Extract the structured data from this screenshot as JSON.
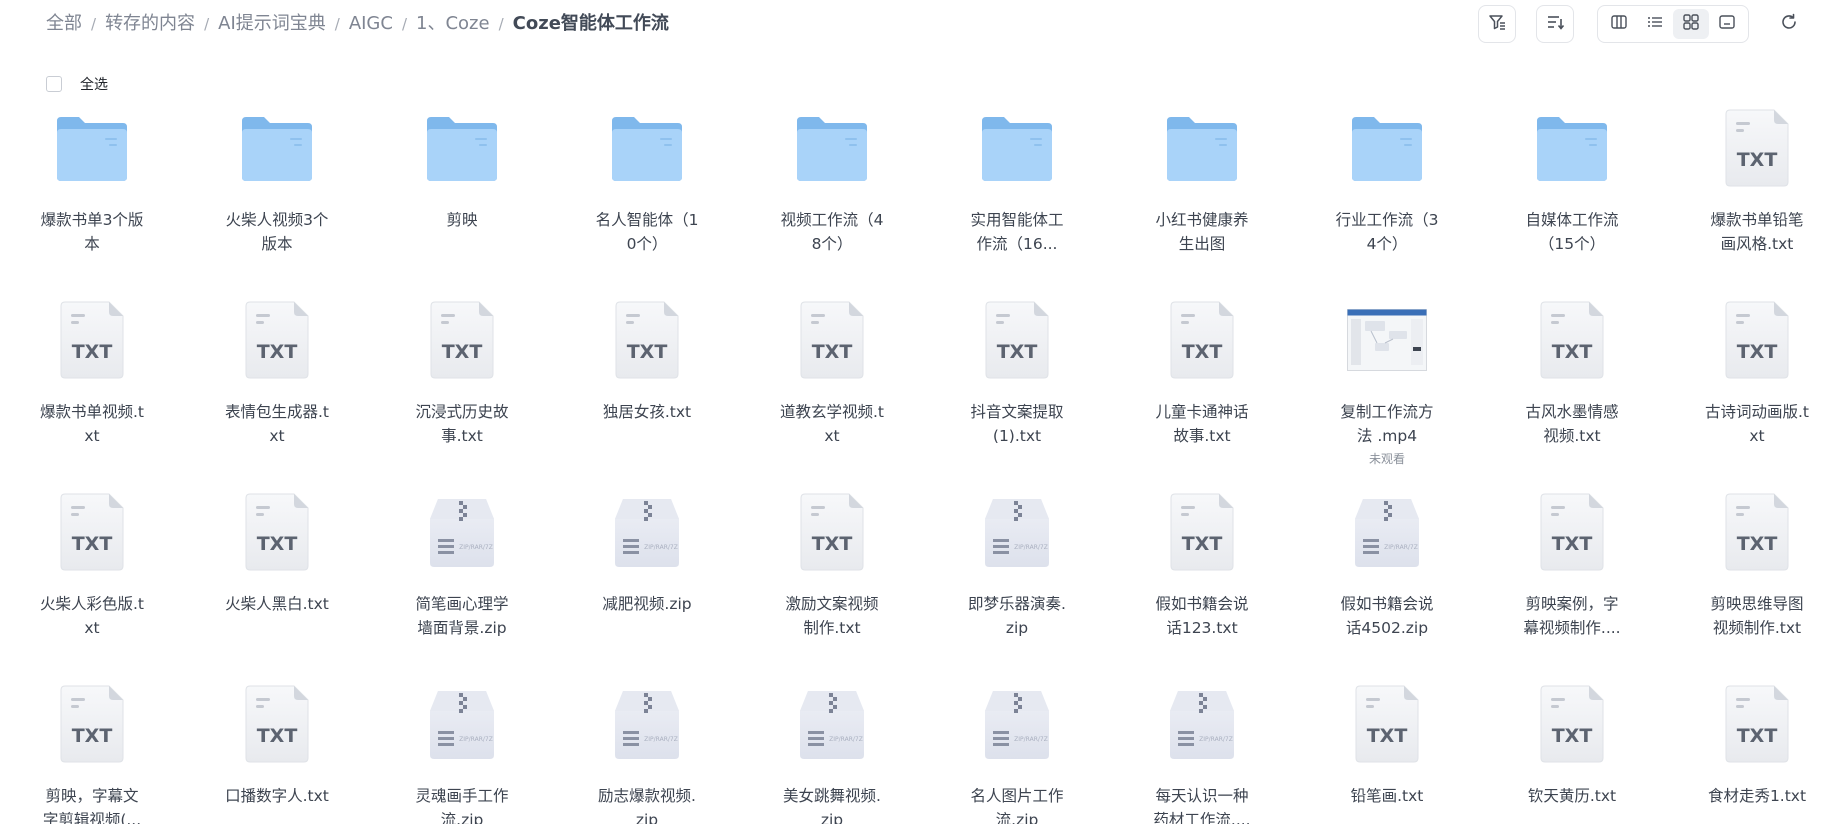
{
  "breadcrumb": [
    "全部",
    "转存的内容",
    "AI提示词宝典",
    "AIGC",
    "1、Coze",
    "Coze智能体工作流"
  ],
  "toolbar": {
    "filter_icon": "filter-icon",
    "sort_icon": "sort-icon",
    "views": [
      "columns-view-icon",
      "list-view-icon",
      "grid-view-icon",
      "preview-view-icon"
    ],
    "active_view": "grid-view-icon",
    "refresh_icon": "refresh-icon"
  },
  "select_all_label": "全选",
  "colors": {
    "folder_back": "#7fb8ec",
    "folder_front": "#a9d3f9",
    "text": "#3d4450",
    "crumb": "#7f8592",
    "crumb_current": "#424a57"
  },
  "items": [
    {
      "name": "爆款书单3个版本",
      "type": "folder"
    },
    {
      "name": "火柴人视频3个版本",
      "type": "folder"
    },
    {
      "name": "剪映",
      "type": "folder"
    },
    {
      "name": "名人智能体（10个）",
      "type": "folder"
    },
    {
      "name": "视频工作流（48个）",
      "type": "folder"
    },
    {
      "name": "实用智能体工作流（16...",
      "type": "folder"
    },
    {
      "name": "小红书健康养生出图",
      "type": "folder"
    },
    {
      "name": "行业工作流（34个）",
      "type": "folder"
    },
    {
      "name": "自媒体工作流（15个）",
      "type": "folder"
    },
    {
      "name": "爆款书单铅笔画风格.txt",
      "type": "txt"
    },
    {
      "name": "爆款书单视频.txt",
      "type": "txt"
    },
    {
      "name": "表情包生成器.txt",
      "type": "txt"
    },
    {
      "name": "沉浸式历史故事.txt",
      "type": "txt"
    },
    {
      "name": "独居女孩.txt",
      "type": "txt"
    },
    {
      "name": "道教玄学视频.txt",
      "type": "txt"
    },
    {
      "name": "抖音文案提取(1).txt",
      "type": "txt"
    },
    {
      "name": "儿童卡通神话故事.txt",
      "type": "txt"
    },
    {
      "name": "复制工作流方法 .mp4",
      "type": "video",
      "note": "未观看"
    },
    {
      "name": "古风水墨情感视频.txt",
      "type": "txt"
    },
    {
      "name": "古诗词动画版.txt",
      "type": "txt"
    },
    {
      "name": "火柴人彩色版.txt",
      "type": "txt"
    },
    {
      "name": "火柴人黑白.txt",
      "type": "txt"
    },
    {
      "name": "简笔画心理学墙面背景.zip",
      "type": "zip"
    },
    {
      "name": "减肥视频.zip",
      "type": "zip"
    },
    {
      "name": "激励文案视频制作.txt",
      "type": "txt"
    },
    {
      "name": "即梦乐器演奏.zip",
      "type": "zip"
    },
    {
      "name": "假如书籍会说话123.txt",
      "type": "txt"
    },
    {
      "name": "假如书籍会说话4502.zip",
      "type": "zip"
    },
    {
      "name": "剪映案例，字幕视频制作....",
      "type": "txt"
    },
    {
      "name": "剪映思维导图视频制作.txt",
      "type": "txt"
    },
    {
      "name": "剪映，字幕文字剪辑视频(...",
      "type": "txt"
    },
    {
      "name": "口播数字人.txt",
      "type": "txt"
    },
    {
      "name": "灵魂画手工作流.zip",
      "type": "zip"
    },
    {
      "name": "励志爆款视频.zip",
      "type": "zip"
    },
    {
      "name": "美女跳舞视频.zip",
      "type": "zip"
    },
    {
      "name": "名人图片工作流.zip",
      "type": "zip"
    },
    {
      "name": "每天认识一种药材工作流....",
      "type": "zip"
    },
    {
      "name": "铅笔画.txt",
      "type": "txt"
    },
    {
      "name": "钦天黄历.txt",
      "type": "txt"
    },
    {
      "name": "食材走秀1.txt",
      "type": "txt"
    }
  ],
  "icon_text": {
    "txt": "TXT",
    "zip": "ZIP/RAR/7Z"
  }
}
